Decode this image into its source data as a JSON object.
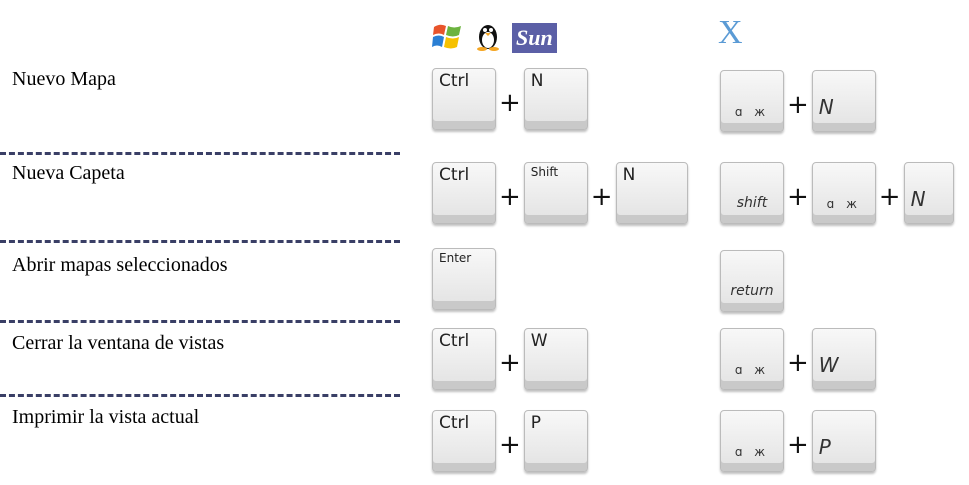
{
  "header": {
    "icons": [
      "windows-icon",
      "linux-tux-icon",
      "sun-logo"
    ],
    "sun_label": "Sun",
    "mac_label": "X"
  },
  "rows": [
    {
      "label": "Nuevo Mapa",
      "win_keys": [
        "Ctrl",
        "N"
      ],
      "mac_keys": [
        "ɑ ж",
        "N"
      ]
    },
    {
      "label": "Nueva Capeta",
      "win_keys": [
        "Ctrl",
        "Shift",
        "N"
      ],
      "mac_keys": [
        "shift",
        "ɑ ж",
        "N"
      ]
    },
    {
      "label": "Abrir mapas seleccionados",
      "win_keys": [
        "Enter"
      ],
      "mac_keys": [
        "return"
      ]
    },
    {
      "label": "Cerrar la ventana de vistas",
      "win_keys": [
        "Ctrl",
        "W"
      ],
      "mac_keys": [
        "ɑ ж",
        "W"
      ]
    },
    {
      "label": "Imprimir la vista actual",
      "win_keys": [
        "Ctrl",
        "P"
      ],
      "mac_keys": [
        "ɑ ж",
        "P"
      ]
    }
  ],
  "plus_sign": "+"
}
